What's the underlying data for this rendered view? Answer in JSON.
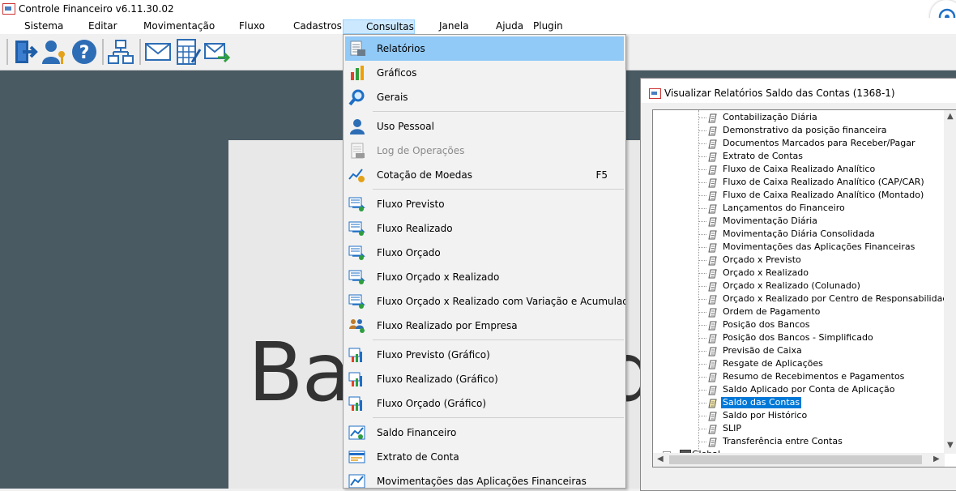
{
  "app": {
    "title": "Controle Financeiro v6.11.30.02"
  },
  "menubar": {
    "items": [
      {
        "label": "Sistema"
      },
      {
        "label": "Editar"
      },
      {
        "label": "Movimentação"
      },
      {
        "label": "Fluxo"
      },
      {
        "label": "Cadastros"
      },
      {
        "label": "Consultas"
      },
      {
        "label": "Janela"
      },
      {
        "label": "Ajuda"
      },
      {
        "label": "Plugin"
      }
    ],
    "active": "Consultas"
  },
  "toolbar": {
    "buttons": [
      {
        "icon": "exit-icon"
      },
      {
        "icon": "user-key-icon"
      },
      {
        "icon": "help-icon"
      },
      {
        "icon": "org-chart-icon"
      },
      {
        "icon": "mail-icon"
      },
      {
        "icon": "calculator-icon"
      },
      {
        "icon": "mail-send-icon"
      }
    ]
  },
  "background": {
    "big_text": "Ba",
    "big_text_right": "d"
  },
  "consultas_menu": {
    "items": [
      {
        "label": "Relatórios",
        "icon": "report-icon",
        "highlighted": true
      },
      {
        "label": "Gráficos",
        "icon": "bar-chart-icon"
      },
      {
        "label": "Gerais",
        "icon": "magnifier-icon"
      },
      {
        "label": "Uso Pessoal",
        "icon": "person-icon"
      },
      {
        "label": "Log de Operações",
        "icon": "log-icon",
        "disabled": true
      },
      {
        "label": "Cotação de Moedas",
        "icon": "currency-chart-icon",
        "shortcut": "F5"
      },
      {
        "label": "Fluxo Previsto",
        "icon": "flow-icon"
      },
      {
        "label": "Fluxo Realizado",
        "icon": "flow-icon"
      },
      {
        "label": "Fluxo Orçado",
        "icon": "flow-icon"
      },
      {
        "label": "Fluxo Orçado x Realizado",
        "icon": "flow-icon"
      },
      {
        "label": "Fluxo Orçado x Realizado com Variação e Acumulado",
        "icon": "flow-icon"
      },
      {
        "label": "Fluxo Realizado por Empresa",
        "icon": "flow-company-icon"
      },
      {
        "label": "Fluxo Previsto (Gráfico)",
        "icon": "flow-chart-icon"
      },
      {
        "label": "Fluxo Realizado (Gráfico)",
        "icon": "flow-chart-icon"
      },
      {
        "label": "Fluxo Orçado (Gráfico)",
        "icon": "flow-chart-icon"
      },
      {
        "label": "Saldo Financeiro",
        "icon": "balance-icon"
      },
      {
        "label": "Extrato de Conta",
        "icon": "statement-icon"
      },
      {
        "label": "Movimentações das Aplicações Financeiras",
        "icon": "investment-icon"
      }
    ]
  },
  "report_window": {
    "title": "Visualizar Relatórios Saldo das Contas (1368-1)",
    "tree_items": [
      {
        "label": "Contabilização Diária"
      },
      {
        "label": "Demonstrativo da posição financeira"
      },
      {
        "label": "Documentos Marcados para Receber/Pagar"
      },
      {
        "label": "Extrato de Contas"
      },
      {
        "label": "Fluxo de Caixa Realizado Analítico"
      },
      {
        "label": "Fluxo de Caixa Realizado Analítico (CAP/CAR)"
      },
      {
        "label": "Fluxo de Caixa Realizado Analítico (Montado)"
      },
      {
        "label": "Lançamentos do Financeiro"
      },
      {
        "label": "Movimentação Diária"
      },
      {
        "label": "Movimentação Diária Consolidada"
      },
      {
        "label": "Movimentações das Aplicações Financeiras"
      },
      {
        "label": "Orçado x Previsto"
      },
      {
        "label": "Orçado x Realizado"
      },
      {
        "label": "Orçado x Realizado (Colunado)"
      },
      {
        "label": "Orçado x Realizado por Centro de Responsabilidade"
      },
      {
        "label": "Ordem de Pagamento"
      },
      {
        "label": "Posição dos Bancos"
      },
      {
        "label": "Posição dos Bancos - Simplificado"
      },
      {
        "label": "Previsão de Caixa"
      },
      {
        "label": "Resgate de Aplicações"
      },
      {
        "label": "Resumo de Recebimentos e Pagamentos"
      },
      {
        "label": "Saldo Aplicado por Conta de Aplicação"
      },
      {
        "label": "Saldo das Contas",
        "selected": true
      },
      {
        "label": "Saldo por Histórico"
      },
      {
        "label": "SLIP"
      },
      {
        "label": "Transferência entre Contas"
      }
    ],
    "global_node": {
      "label": "Global"
    }
  }
}
